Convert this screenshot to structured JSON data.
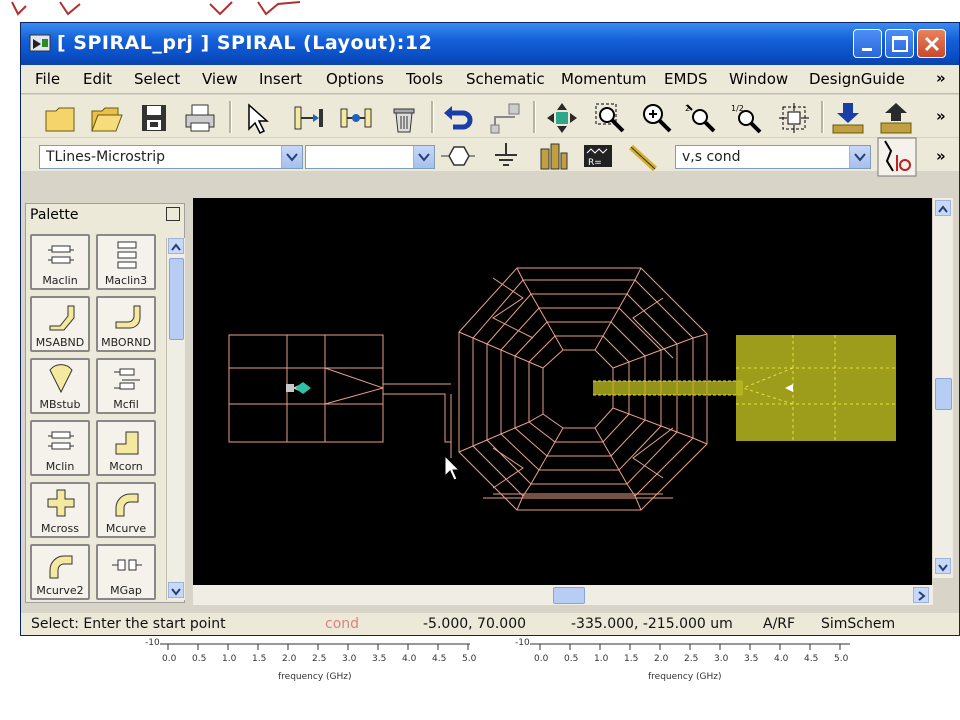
{
  "window": {
    "title": "[ SPIRAL_prj ] SPIRAL (Layout):12"
  },
  "menu": {
    "items": [
      "File",
      "Edit",
      "Select",
      "View",
      "Insert",
      "Options",
      "Tools",
      "Schematic",
      "Momentum",
      "EMDS",
      "Window",
      "DesignGuide"
    ],
    "overflow": "»"
  },
  "toolbar": {
    "icons": [
      "new-file-icon",
      "open-folder-icon",
      "save-icon",
      "print-icon",
      "select-arrow-icon",
      "move-component-icon",
      "rotate-component-icon",
      "delete-trash-icon",
      "undo-icon",
      "insert-wire-icon",
      "pan-icon",
      "zoom-area-icon",
      "zoom-in-icon",
      "zoom-point-icon",
      "zoom-out-icon",
      "fit-view-icon",
      "push-into-hierarchy-icon",
      "pop-out-hierarchy-icon"
    ],
    "overflow": "»",
    "library_combo_value": "TLines-Microstrip",
    "component_combo_value": "",
    "layer_combo_value": "v,s cond",
    "row2_icons": [
      "polygon-icon",
      "ground-icon",
      "building-icon",
      "resistor-box-icon",
      "pencil-icon",
      "toggle-insert-icon"
    ],
    "row2_overflow": "»"
  },
  "palette": {
    "title": "Palette",
    "items": [
      {
        "label": "Maclin",
        "icon": "maclin-icon"
      },
      {
        "label": "Maclin3",
        "icon": "maclin3-icon"
      },
      {
        "label": "MSABND",
        "icon": "msabnd-icon"
      },
      {
        "label": "MBORND",
        "icon": "mbornd-icon"
      },
      {
        "label": "MBstub",
        "icon": "mbstub-icon"
      },
      {
        "label": "Mcfil",
        "icon": "mcfil-icon"
      },
      {
        "label": "Mclin",
        "icon": "mclin-icon"
      },
      {
        "label": "Mcorn",
        "icon": "mcorn-icon"
      },
      {
        "label": "Mcross",
        "icon": "mcross-icon"
      },
      {
        "label": "Mcurve",
        "icon": "mcurve-icon"
      },
      {
        "label": "Mcurve2",
        "icon": "mcurve2-icon"
      },
      {
        "label": "MGap",
        "icon": "mgap-icon"
      }
    ]
  },
  "status": {
    "prompt": "Select: Enter the start point",
    "layer": "cond",
    "cursor_coords": "-5.000, 70.000",
    "world_coords": "-335.000, -215.000 um",
    "mode": "A/RF",
    "sim": "SimSchem"
  },
  "background_axes": {
    "left_ticks": [
      "0.0",
      "0.5",
      "1.0",
      "1.5",
      "2.0",
      "2.5",
      "3.0",
      "3.5",
      "4.0",
      "4.5",
      "5.0"
    ],
    "right_ticks": [
      "0.0",
      "0.5",
      "1.0",
      "1.5",
      "2.0",
      "2.5",
      "3.0",
      "3.5",
      "4.0",
      "4.5",
      "5.0"
    ],
    "left_label": "frequency (GHz)",
    "right_label": "frequency (GHz)",
    "left_start": "-10",
    "right_start": "-10"
  },
  "colors": {
    "title_bar": "#0a4ec4",
    "layout_lines": "#e8a088",
    "port_pad": "#b8b820",
    "canvas": "#000000"
  }
}
